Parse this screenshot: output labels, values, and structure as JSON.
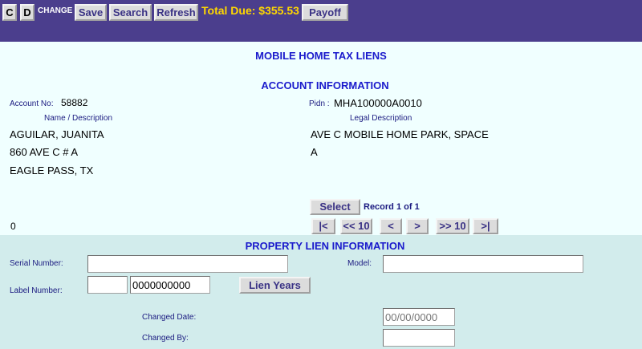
{
  "toolbar": {
    "c_label": "C",
    "d_label": "D",
    "change_label": "CHANGE",
    "save_label": "Save",
    "search_label": "Search",
    "refresh_label": "Refresh",
    "total_due": "Total Due: $355.53",
    "payoff_label": "Payoff"
  },
  "page": {
    "title": "MOBILE HOME TAX LIENS",
    "account_section_title": "ACCOUNT INFORMATION",
    "lien_section_title": "PROPERTY LIEN INFORMATION"
  },
  "account": {
    "account_no_label": "Account No:",
    "account_no": "58882",
    "pidn_label": "Pidn :",
    "pidn": "MHA100000A0010",
    "name_header": "Name / Description",
    "legal_header": "Legal Description",
    "name_lines": [
      "AGUILAR, JUANITA",
      "860 AVE C # A",
      "EAGLE PASS, TX"
    ],
    "legal_lines": [
      "AVE C MOBILE HOME PARK, SPACE",
      "A"
    ],
    "count": "0"
  },
  "record_nav": {
    "select_label": "Select",
    "record_text": "Record 1 of 1",
    "first_label": "|<",
    "back10_label": "<< 10",
    "prev_label": "<",
    "next_label": ">",
    "fwd10_label": ">> 10",
    "last_label": ">|"
  },
  "lien": {
    "serial_label": "Serial Number:",
    "serial_value": "",
    "model_label": "Model:",
    "model_value": "",
    "label_number_label": "Label Number:",
    "label_number_prefix": "",
    "label_number_value": "0000000000",
    "lien_years_label": "Lien Years",
    "changed_date_label": "Changed Date:",
    "changed_date_placeholder": "00/00/0000",
    "changed_by_label": "Changed By:",
    "changed_by_value": ""
  },
  "colors": {
    "toolbar_bg": "#4b3e8d",
    "page_bg": "#f0ffff",
    "lower_bg": "#d2ecec",
    "title_blue": "#1a1acc",
    "total_due_yellow": "#ffd700",
    "button_text": "#3a3285"
  }
}
